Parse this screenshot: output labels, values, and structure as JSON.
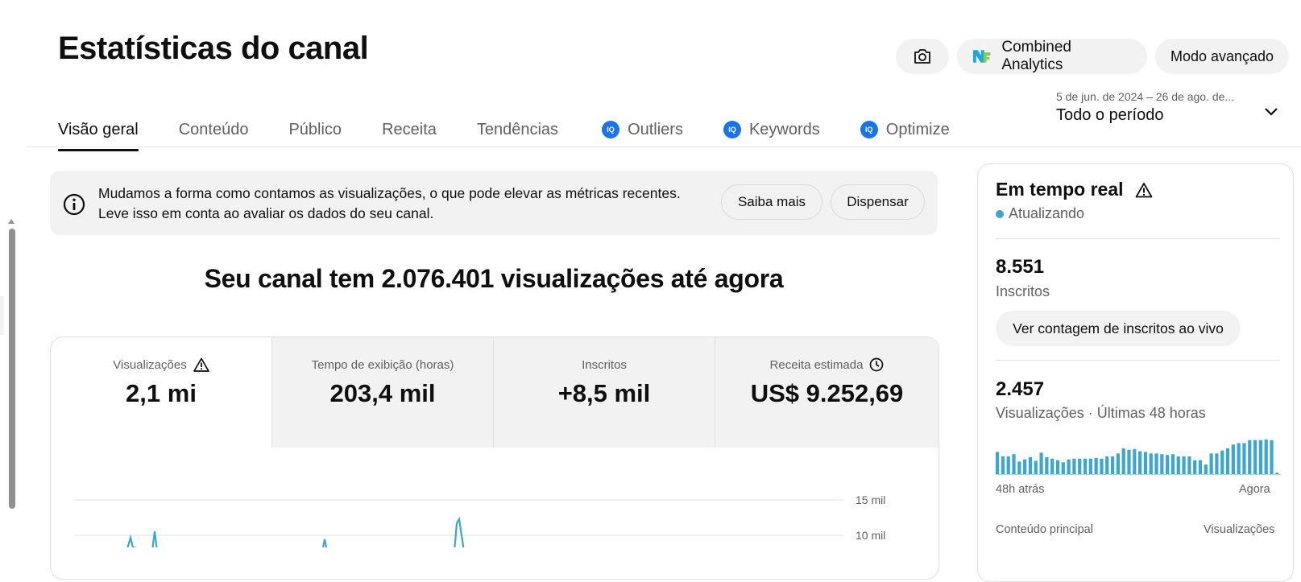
{
  "header": {
    "title": "Estatísticas do canal",
    "combined_label": "Combined Analytics",
    "advanced_label": "Modo avançado",
    "icons": {
      "camera": "camera-icon",
      "combined_logo": "nexlev-logo-icon"
    }
  },
  "tabs": [
    {
      "label": "Visão geral",
      "active": true
    },
    {
      "label": "Conteúdo"
    },
    {
      "label": "Público"
    },
    {
      "label": "Receita"
    },
    {
      "label": "Tendências"
    },
    {
      "label": "Outliers",
      "badge": "IQ"
    },
    {
      "label": "Keywords",
      "badge": "IQ"
    },
    {
      "label": "Optimize",
      "badge": "IQ"
    }
  ],
  "date_range": {
    "sub": "5 de jun. de 2024 – 26 de ago. de...",
    "main": "Todo o período"
  },
  "notice": {
    "line1": "Mudamos a forma como contamos as visualizações, o que pode elevar as métricas recentes.",
    "line2": "Leve isso em conta ao avaliar os dados do seu canal.",
    "learn_more": "Saiba mais",
    "dismiss": "Dispensar"
  },
  "headline": "Seu canal tem 2.076.401 visualizações até agora",
  "metrics": [
    {
      "label": "Visualizações",
      "value": "2,1 mi",
      "icon": "warning-icon",
      "selected": true
    },
    {
      "label": "Tempo de exibição (horas)",
      "value": "203,4 mil"
    },
    {
      "label": "Inscritos",
      "value": "+8,5 mil"
    },
    {
      "label": "Receita estimada",
      "value": "US$ 9.252,69",
      "icon": "clock-icon"
    }
  ],
  "main_chart": {
    "y_ticks": [
      "15 mil",
      "10 mil"
    ],
    "accent": "#3ea6cc"
  },
  "realtime": {
    "title": "Em tempo real",
    "status": "Atualizando",
    "subscribers_value": "8.551",
    "subscribers_label": "Inscritos",
    "live_button": "Ver contagem de inscritos ao vivo",
    "views_value": "2.457",
    "views_label": "Visualizações · Últimas 48 horas",
    "axis_start": "48h atrás",
    "axis_end": "Agora",
    "content_header": "Conteúdo principal",
    "content_metric": "Visualizações",
    "bars": [
      0.62,
      0.5,
      0.5,
      0.56,
      0.36,
      0.42,
      0.48,
      0.38,
      0.6,
      0.48,
      0.44,
      0.4,
      0.34,
      0.42,
      0.44,
      0.44,
      0.44,
      0.44,
      0.46,
      0.44,
      0.5,
      0.5,
      0.58,
      0.72,
      0.68,
      0.7,
      0.64,
      0.62,
      0.58,
      0.58,
      0.56,
      0.54,
      0.56,
      0.5,
      0.5,
      0.5,
      0.4,
      0.4,
      0.28,
      0.58,
      0.58,
      0.66,
      0.72,
      0.82,
      0.86,
      0.86,
      0.94,
      0.94,
      0.94,
      0.96,
      0.94,
      0.06
    ]
  }
}
